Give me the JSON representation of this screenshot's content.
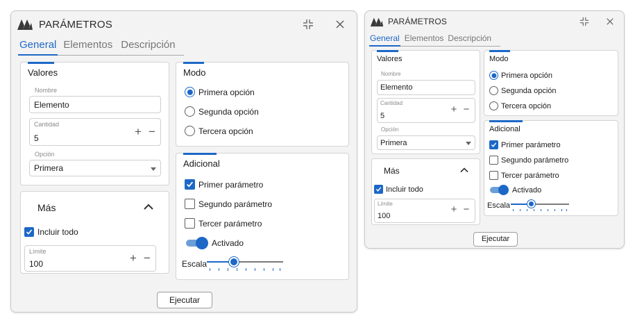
{
  "colors": {
    "accent": "#1d68c7",
    "window_bg": "#f3f3f3",
    "panel_bg": "#ffffff"
  },
  "icons": {
    "logo": "logo-icon",
    "minimize": "collapse-icon",
    "close": "close-icon",
    "expand": "chevron-up-icon",
    "dropdown": "chevron-down-icon"
  },
  "window_large": {
    "title": "PARÁMETROS",
    "tabs": [
      "General",
      "Elementos",
      "Descripción"
    ],
    "valores": {
      "title": "Valores",
      "nombre": {
        "label": "Nombre",
        "value": "Elemento"
      },
      "cantidad": {
        "label": "Cantidad",
        "value": "5",
        "plus": "+",
        "minus": "−"
      },
      "opcion": {
        "label": "Opción",
        "value": "Primera"
      }
    },
    "mas": {
      "title": "Más",
      "incluir": "Incluir todo",
      "limite": {
        "label": "Límite",
        "value": "100",
        "plus": "+",
        "minus": "−"
      }
    },
    "modo": {
      "title": "Modo",
      "options": [
        "Primera opción",
        "Segunda opción",
        "Tercera opción"
      ],
      "selected": 0
    },
    "adicional": {
      "title": "Adicional",
      "checks": [
        "Primer parámetro",
        "Segundo parámetro",
        "Tercer parámetro"
      ],
      "checked": [
        true,
        false,
        false
      ],
      "toggle": "Activado",
      "toggle_on": true,
      "slider_label": "Escala",
      "slider_value": 0.35
    },
    "run": "Ejecutar"
  },
  "window_small": {
    "title": "PARÁMETROS",
    "tabs": [
      "General",
      "Elementos",
      "Descripción"
    ],
    "valores": {
      "title": "Valores",
      "nombre": {
        "label": "Nombre",
        "value": "Elemento"
      },
      "cantidad": {
        "label": "Cantidad",
        "value": "5",
        "plus": "+",
        "minus": "−"
      },
      "opcion": {
        "label": "Opción",
        "value": "Primera"
      }
    },
    "mas": {
      "title": "Más",
      "incluir": "Incluir todo",
      "limite": {
        "label": "Límite",
        "value": "100",
        "plus": "+",
        "minus": "−"
      }
    },
    "modo": {
      "title": "Modo",
      "options": [
        "Primera opción",
        "Segunda opción",
        "Tercera opción"
      ],
      "selected": 0
    },
    "adicional": {
      "title": "Adicional",
      "checks": [
        "Primer parámetro",
        "Segundo parámetro",
        "Tercer parámetro"
      ],
      "checked": [
        true,
        false,
        false
      ],
      "toggle": "Activado",
      "toggle_on": true,
      "slider_label": "Escala",
      "slider_value": 0.35
    },
    "run": "Ejecutar"
  }
}
